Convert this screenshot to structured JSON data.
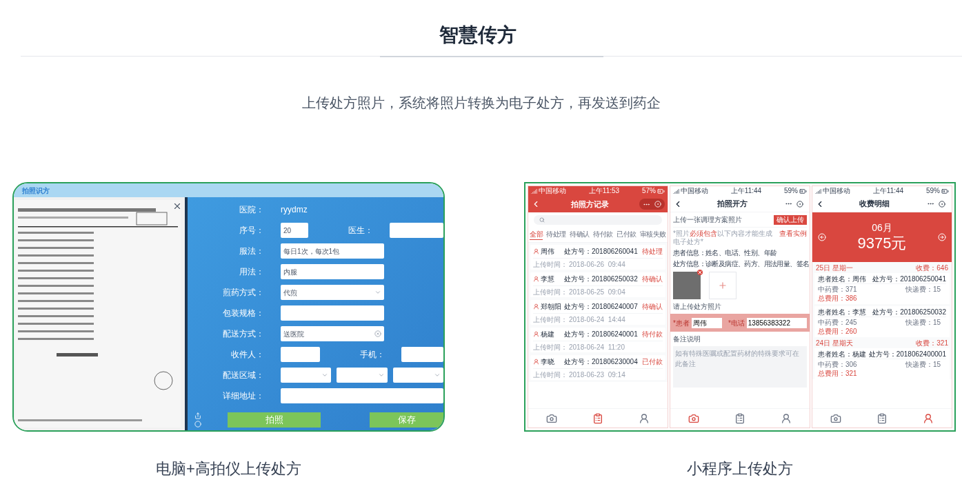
{
  "header": {
    "title": "智慧传方",
    "subtitle": "上传处方照片，系统将照片转换为电子处方，再发送到药企"
  },
  "desktop": {
    "app_title": "拍照识方",
    "rows": [
      {
        "kind": "info",
        "fields": [
          {
            "label": "医院：",
            "value": "ryydmz"
          }
        ]
      },
      {
        "kind": "pair",
        "fields": [
          {
            "label": "序号：",
            "kind": "input",
            "value": "20"
          },
          {
            "label": "医生：",
            "kind": "input"
          }
        ]
      },
      {
        "kind": "single",
        "fields": [
          {
            "label": "服法：",
            "kind": "input",
            "value": "每日1次，每次1包"
          }
        ]
      },
      {
        "kind": "single",
        "fields": [
          {
            "label": "用法：",
            "kind": "input",
            "value": "内服"
          }
        ]
      },
      {
        "kind": "single",
        "fields": [
          {
            "label": "煎药方式：",
            "kind": "select",
            "value": "代煎"
          }
        ]
      },
      {
        "kind": "single",
        "fields": [
          {
            "label": "包装规格：",
            "kind": "input"
          }
        ]
      },
      {
        "kind": "single",
        "fields": [
          {
            "label": "配送方式：",
            "kind": "combo",
            "value": "送医院"
          }
        ]
      },
      {
        "kind": "pair",
        "fields": [
          {
            "label": "收件人：",
            "kind": "input"
          },
          {
            "label": "手机：",
            "kind": "input"
          }
        ]
      },
      {
        "kind": "region",
        "fields": [
          {
            "label": "配送区域：",
            "kind": "select"
          },
          {
            "kind": "select"
          },
          {
            "kind": "select"
          }
        ]
      },
      {
        "kind": "wide",
        "fields": [
          {
            "label": "详细地址：",
            "kind": "input"
          }
        ]
      }
    ],
    "buttons": [
      "拍照",
      "保存"
    ],
    "caption": "电脑+高拍仪上传处方"
  },
  "mini_program": {
    "caption": "小程序上传处方",
    "screens": [
      {
        "kind": "records",
        "status": {
          "carrier": "中国移动",
          "time": "上午11:53",
          "battery": "57%"
        },
        "title": "拍照方记录",
        "tabs": [
          {
            "label": "全部",
            "selected": true
          },
          {
            "label": "待处理",
            "selected": false
          },
          {
            "label": "待确认",
            "selected": false
          },
          {
            "label": "待付款",
            "selected": false
          },
          {
            "label": "已付款",
            "selected": false
          },
          {
            "label": "审核失败",
            "selected": false
          }
        ],
        "records": [
          {
            "name": "周伟",
            "number": "处方号：201806260041",
            "status": "待处理",
            "time_label": "上传时间：",
            "time": "2018-06-26  09:44"
          },
          {
            "name": "李慧",
            "number": "处方号：201806250032",
            "status": "待确认",
            "time_label": "上传时间：",
            "time": "2018-06-25  09:04"
          },
          {
            "name": "郑朝阳",
            "number": "处方号：201806240007",
            "status": "待确认",
            "time_label": "上传时间：",
            "time": "2018-06-24  14:44"
          },
          {
            "name": "杨建",
            "number": "处方号：201806240001",
            "status": "待付款",
            "time_label": "上传时间：",
            "time": "2018-06-24  11:20"
          },
          {
            "name": "李晓",
            "number": "处方号：201806230004",
            "status": "已付款",
            "time_label": "上传时间：",
            "time": "2018-06-23  09:14"
          }
        ],
        "tabbar": [
          {
            "kind": "camera",
            "selected": false
          },
          {
            "kind": "clipboard",
            "selected": true
          },
          {
            "kind": "contacts",
            "selected": false
          }
        ]
      },
      {
        "kind": "upload",
        "status": {
          "carrier": "中国移动",
          "time": "上午11:44",
          "battery": "59%"
        },
        "title": "拍照开方",
        "upload_label": "上传一张调理方案照片",
        "confirm_button": "确认上传",
        "note": {
          "before": "*照片",
          "emphasis": "必须包含",
          "after": "以下内容才能生成电子处方*"
        },
        "example_link": "查看实例",
        "info": [
          "患者信息：姓名、电话、性别、年龄",
          "处方信息：诊断及病症、药方、用法用量、签名"
        ],
        "photo_hint": "请上传处方照片",
        "patient": {
          "label": "*患者",
          "value": "周伟"
        },
        "phone": {
          "label": "*电话",
          "value": "13856383322"
        },
        "remark": {
          "label": "备注说明",
          "placeholder": "如有特殊医嘱或配置药材的特殊要求可在此备注"
        },
        "tabbar": [
          {
            "kind": "camera",
            "selected": true
          },
          {
            "kind": "clipboard",
            "selected": false
          },
          {
            "kind": "contacts",
            "selected": false
          }
        ]
      },
      {
        "kind": "billing",
        "status": {
          "carrier": "中国移动",
          "time": "上午11:44",
          "battery": "59%"
        },
        "title": "收费明细",
        "month": "06月",
        "total": "9375元",
        "days": [
          {
            "date": "25日 星期一",
            "fee": "收费：646",
            "bills": [
              {
                "patient": "患者姓名：周伟",
                "number": "处方号：201806250041",
                "medicine": "中药费：371",
                "delivery": "快递费：15",
                "total": "总费用：386"
              },
              {
                "patient": "患者姓名：李慧",
                "number": "处方号：201806250032",
                "medicine": "中药费：245",
                "delivery": "快递费：15",
                "total": "总费用：260"
              }
            ]
          },
          {
            "date": "24日 星期天",
            "fee": "收费：321",
            "bills": [
              {
                "patient": "患者姓名：杨建",
                "number": "处方号：2018062400001",
                "medicine": "中药费：306",
                "delivery": "快递费：15",
                "total": "总费用：321"
              }
            ]
          }
        ],
        "tabbar": [
          {
            "kind": "camera",
            "selected": false
          },
          {
            "kind": "clipboard",
            "selected": false
          },
          {
            "kind": "contacts",
            "selected": true
          }
        ]
      }
    ]
  }
}
